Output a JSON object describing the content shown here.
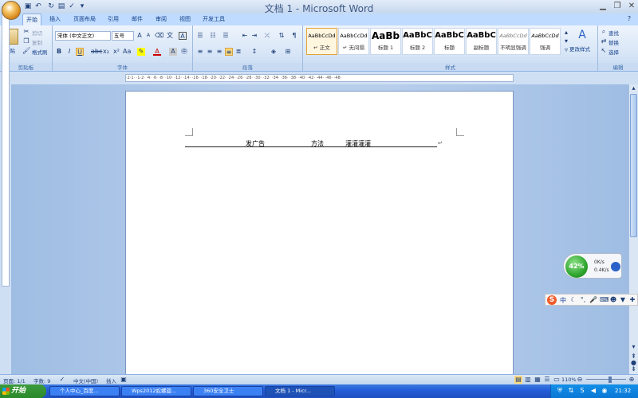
{
  "window": {
    "title": "文档 1 - Microsoft Word"
  },
  "qat": {
    "save_icon": "save-icon",
    "undo_icon": "undo-icon",
    "redo_icon": "redo-icon"
  },
  "tabs": [
    "开始",
    "插入",
    "页面布局",
    "引用",
    "邮件",
    "审阅",
    "视图",
    "开发工具"
  ],
  "ribbon": {
    "clipboard": {
      "paste": "粘贴",
      "cut": "剪切",
      "copy": "复制",
      "format_painter": "格式刷",
      "label": "剪贴板"
    },
    "font": {
      "name": "宋体 (中文正文)",
      "size": "五号",
      "label": "字体"
    },
    "paragraph": {
      "label": "段落"
    },
    "styles": {
      "label": "样式",
      "items": [
        {
          "preview": "AaBbCcDd",
          "name": "↵ 正文"
        },
        {
          "preview": "AaBbCcDd",
          "name": "↵ 无间隔"
        },
        {
          "preview": "AaBb",
          "name": "标题 1"
        },
        {
          "preview": "AaBbC",
          "name": "标题 2"
        },
        {
          "preview": "AaBbC",
          "name": "标题"
        },
        {
          "preview": "AaBbC",
          "name": "副标题"
        },
        {
          "preview": "AaBbCcDd",
          "name": "不明显强调"
        },
        {
          "preview": "AaBbCcDd",
          "name": "强调"
        }
      ],
      "change_styles": "更改样式"
    },
    "editing": {
      "find": "查找",
      "replace": "替换",
      "select": "选择",
      "label": "编辑"
    }
  },
  "ruler": {
    "ticks": "·2·1·  ·1·2·  ·4·  ·6·  ·8·  ·10·  ·12·  ·14·  ·16·  ·18·  ·20·  ·22·  ·24·  ·26·  ·28·  ·30·  ·32·  ·34·  ·36·  ·38·  ·40·  ·42·  ·44·  ·46·  ·48·"
  },
  "document": {
    "text1": "发广告",
    "text2": "方法",
    "text3": "灌灌灌灌",
    "para_mark": "↵"
  },
  "status": {
    "page": "页面: 1/1",
    "words": "字数: 9",
    "language": "中文(中国)",
    "insert": "插入",
    "zoom": "110%"
  },
  "net_widget": {
    "percent": "42%",
    "up": "0K/s",
    "down": "0.4K/s"
  },
  "ime": {
    "mode": "中"
  },
  "taskbar": {
    "start": "开始",
    "tasks": [
      "个人中心_百度...",
      "Wps2012蛇螺旋...",
      "360安全卫士",
      "文档 1 - Micr..."
    ],
    "time": "21:32"
  }
}
